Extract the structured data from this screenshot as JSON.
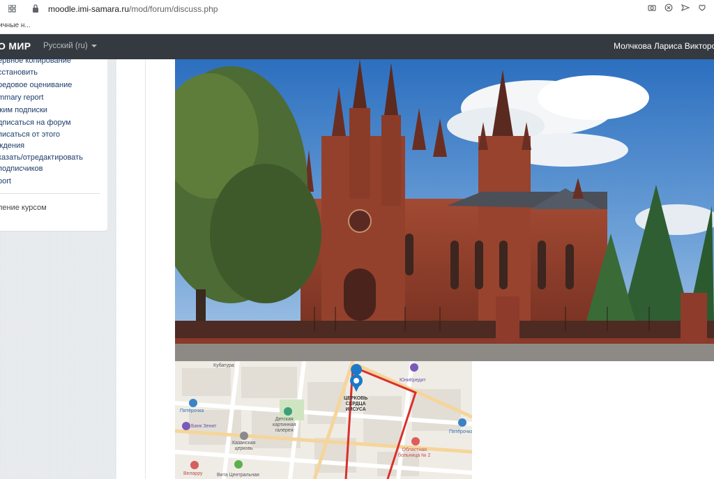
{
  "browser": {
    "url_domain": "moodle.imi-samara.ru",
    "url_path": "/mod/forum/discuss.php",
    "bookmark": "ичные н..."
  },
  "navbar": {
    "brand": "О МИР",
    "language": "Русский (ru)",
    "user": "Молчкова Лариса Викторовна"
  },
  "menu": {
    "items": [
      "ервное копирование",
      "сстановить",
      "редовое оценивание",
      "mmary report",
      "жим подписки",
      "дписаться на форум",
      "писаться от этого",
      "ждения",
      "казать/отредактировать",
      "подписчиков",
      "port"
    ],
    "footer": "ление курсом"
  },
  "map": {
    "labels": {
      "kubatura": "Кубатура",
      "unicredit": "ЮниКредит",
      "church": "ЦЕРКОВЬ\nСЕРДЦА\nИИСУСА",
      "pyaterochka1": "Пятёрочка",
      "pyaterochka2": "Пятёрочка",
      "gallery": "Детская\nкартинная\nгалерея",
      "bank": "Банк Зенит",
      "kazan": "Казанская\nцерковь",
      "hospital": "Областная\nбольница № 2",
      "vita": "Вита Центральная",
      "velarru": "Веларру"
    }
  },
  "colors": {
    "navbar": "#343a40",
    "sidebar_bg": "#e9ecef",
    "link": "#1d3d6a",
    "route": "#d9302c"
  }
}
